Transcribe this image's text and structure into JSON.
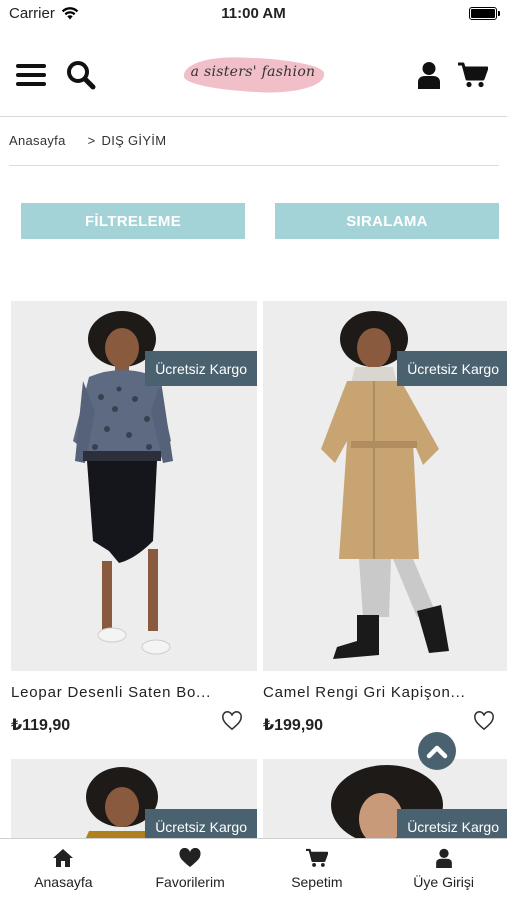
{
  "status_bar": {
    "carrier": "Carrier",
    "time": "11:00 AM"
  },
  "header": {
    "logo_text": "a sisters' fashion"
  },
  "breadcrumb": {
    "home": "Anasayfa",
    "separator": ">",
    "current": "DIŞ GİYİM"
  },
  "actions": {
    "filter": "FİLTRELEME",
    "sort": "SIRALAMA"
  },
  "products": [
    {
      "name": "Leopar Desenli Saten Bo...",
      "price": "₺119,90",
      "badge": "Ücretsiz Kargo"
    },
    {
      "name": "Camel Rengi Gri Kapişon...",
      "price": "₺199,90",
      "badge": "Ücretsiz Kargo"
    },
    {
      "badge": "Ücretsiz Kargo"
    },
    {
      "badge": "Ücretsiz Kargo"
    }
  ],
  "tabbar": [
    {
      "label": "Anasayfa",
      "icon": "home-icon"
    },
    {
      "label": "Favorilerim",
      "icon": "heart-icon"
    },
    {
      "label": "Sepetim",
      "icon": "cart-icon"
    },
    {
      "label": "Üye Girişi",
      "icon": "user-icon"
    }
  ],
  "colors": {
    "accent_button": "#a3d3d6",
    "badge": "#4a6270",
    "logo_brush": "#f1bfc8"
  }
}
